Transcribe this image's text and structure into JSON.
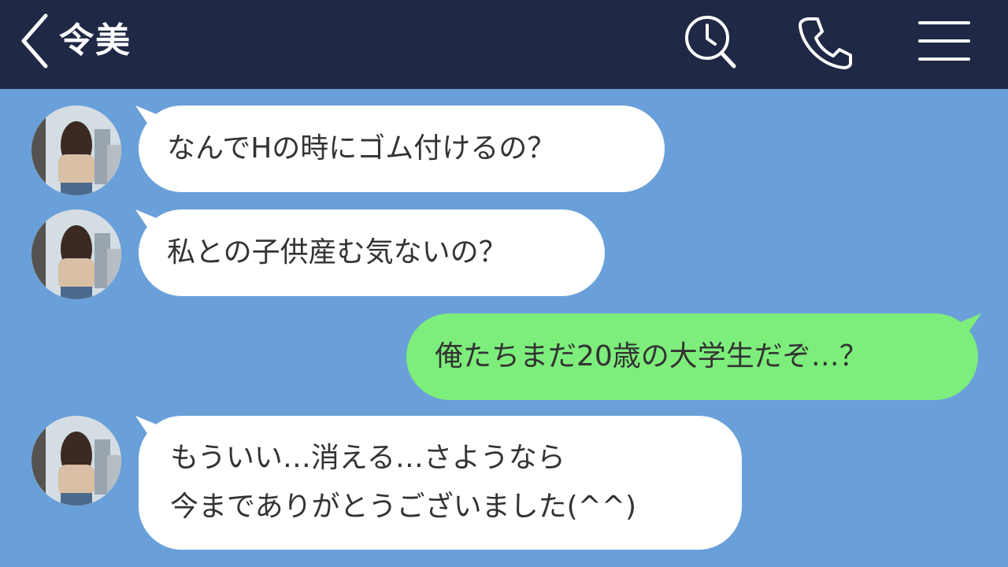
{
  "header": {
    "contact_name": "令美",
    "icons": [
      "chevron-left-icon",
      "search-history-icon",
      "phone-icon",
      "menu-icon"
    ]
  },
  "colors": {
    "header_bg": "#1f2945",
    "chat_bg": "#6aa0d9",
    "incoming_bubble": "#ffffff",
    "outgoing_bubble": "#7ded7b",
    "text": "#333333"
  },
  "messages": [
    {
      "sender": "contact",
      "lines": [
        "なんでHの時にゴム付けるの？"
      ]
    },
    {
      "sender": "contact",
      "lines": [
        "私との子供産む気ないの？"
      ]
    },
    {
      "sender": "me",
      "lines": [
        "俺たちまだ20歳の大学生だぞ…？"
      ]
    },
    {
      "sender": "contact",
      "lines": [
        "もういい…消える…さようなら",
        "今までありがとうございました(^^)"
      ]
    }
  ]
}
